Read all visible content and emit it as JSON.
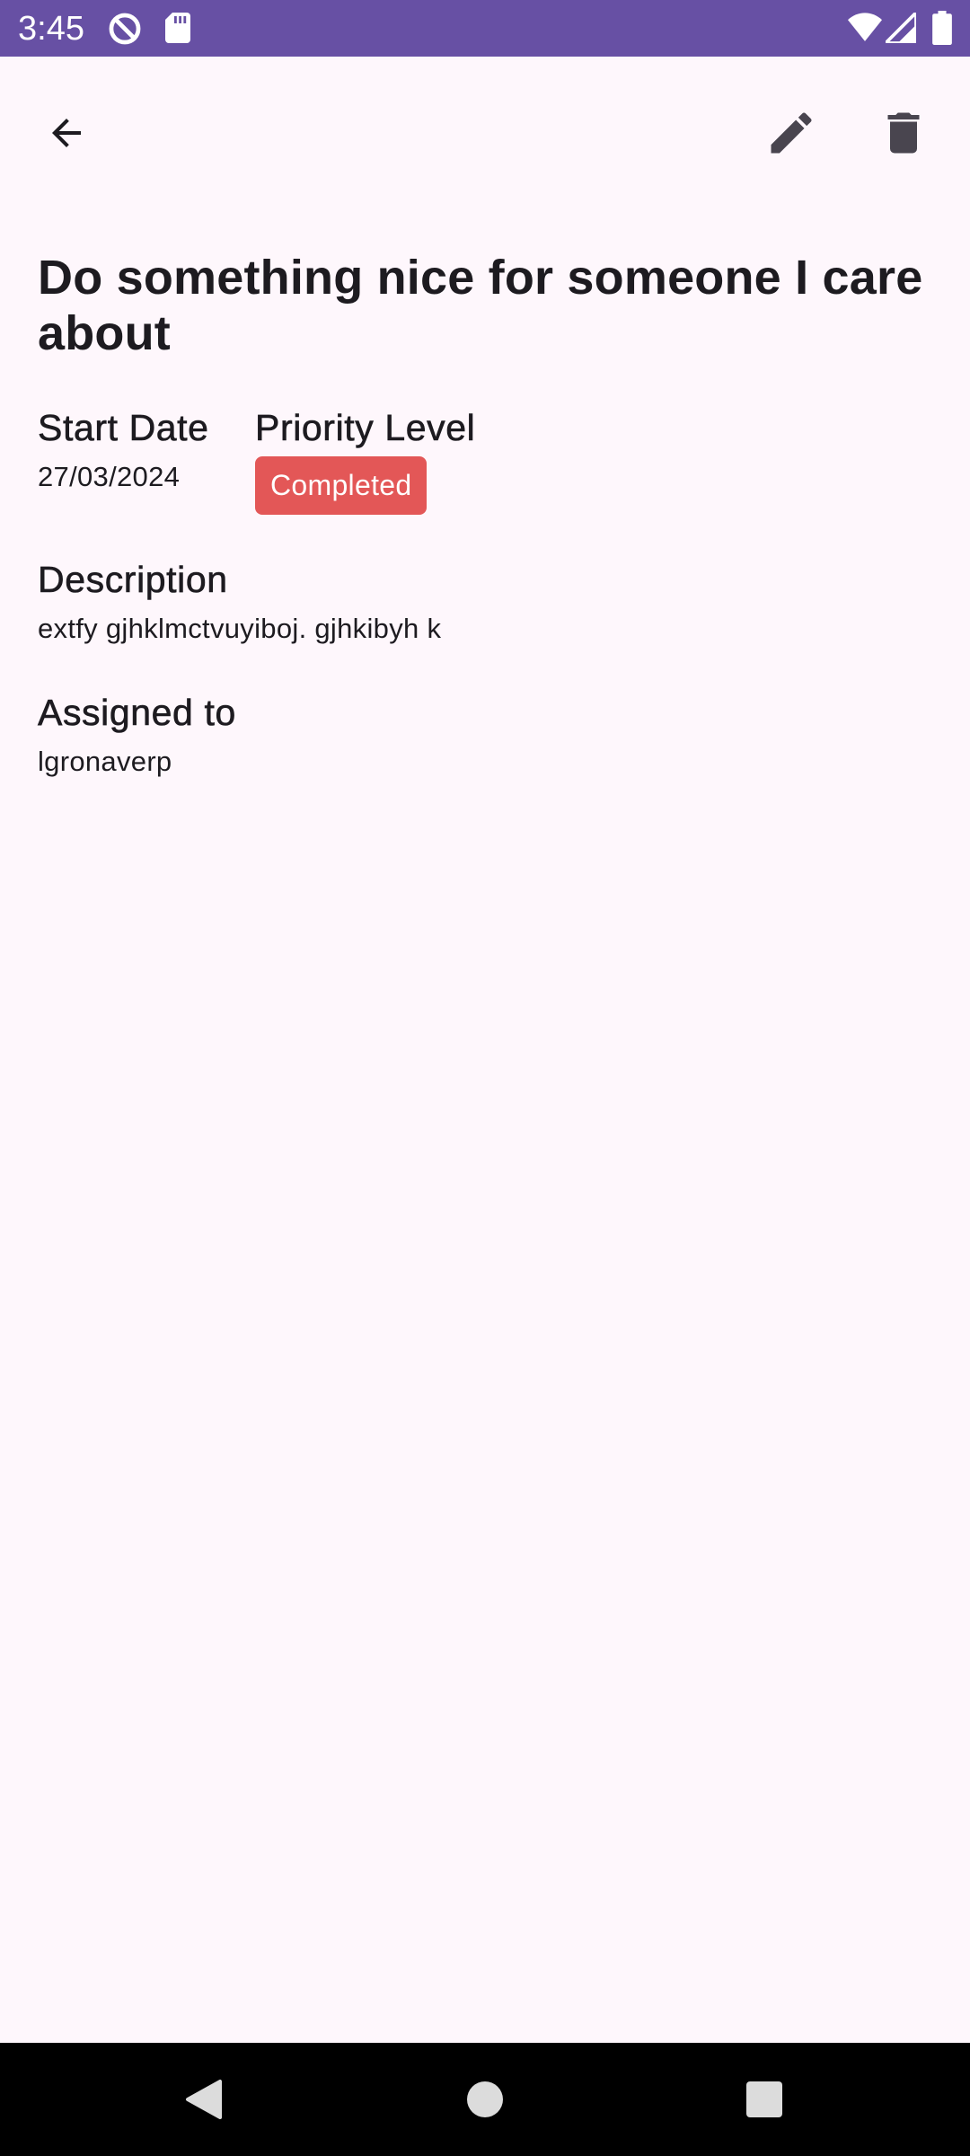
{
  "status_bar": {
    "time": "3:45",
    "background_color": "#6750a4",
    "left_icons": [
      "do-not-disturb-icon",
      "sd-card-icon"
    ],
    "right_icons": [
      "wifi-icon",
      "signal-icon",
      "battery-icon"
    ]
  },
  "app_bar": {
    "back_icon": "arrow-back-icon",
    "edit_icon": "pencil-icon",
    "delete_icon": "trash-icon"
  },
  "task": {
    "title": "Do something nice for someone I care about",
    "start_date_label": "Start Date",
    "start_date": "27/03/2024",
    "priority_label": "Priority Level",
    "priority_value": "Completed",
    "priority_color": "#e35757",
    "description_label": "Description",
    "description": "extfy gjhklmctvuyiboj. gjhkibyh k",
    "assigned_label": "Assigned to",
    "assigned_to": "lgronaverp"
  },
  "nav_bar": {
    "back_icon": "nav-back-icon",
    "home_icon": "nav-home-icon",
    "recents_icon": "nav-recents-icon"
  },
  "colors": {
    "background": "#fef7fc",
    "text": "#1d1b20",
    "nav_background": "#000000"
  }
}
